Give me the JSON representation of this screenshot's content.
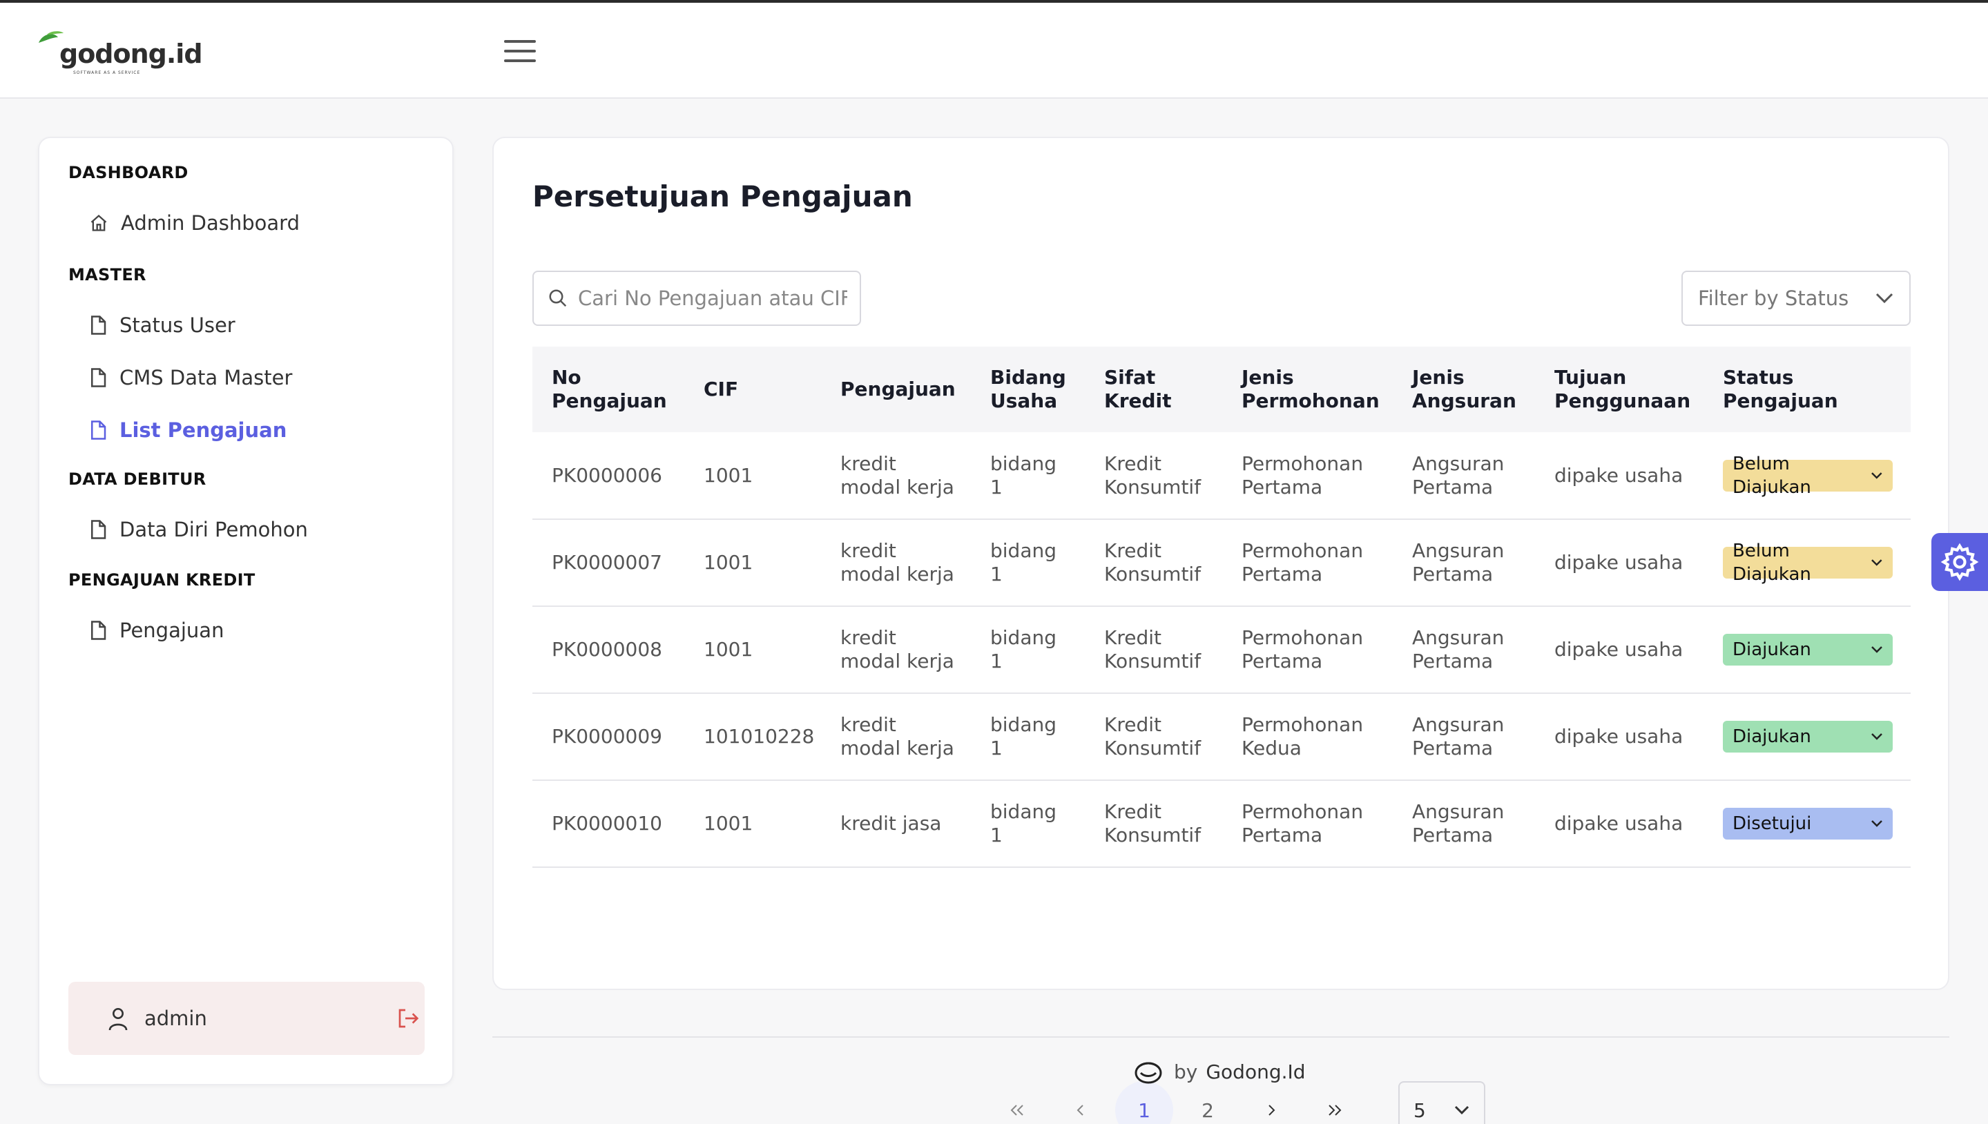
{
  "brand": {
    "name": "godong.id",
    "tagline": "SOFTWARE AS A SERVICE"
  },
  "sidebar": {
    "sections": [
      {
        "title": "DASHBOARD",
        "items": [
          {
            "label": "Admin Dashboard",
            "icon": "home-icon"
          }
        ]
      },
      {
        "title": "MASTER",
        "items": [
          {
            "label": "Status User",
            "icon": "file-icon"
          },
          {
            "label": "CMS Data Master",
            "icon": "file-icon"
          },
          {
            "label": "List Pengajuan",
            "icon": "file-icon",
            "active": true
          }
        ]
      },
      {
        "title": "DATA DEBITUR",
        "items": [
          {
            "label": "Data Diri Pemohon",
            "icon": "file-icon"
          }
        ]
      },
      {
        "title": "PENGAJUAN KREDIT",
        "items": [
          {
            "label": "Pengajuan",
            "icon": "file-icon"
          }
        ]
      }
    ],
    "user": {
      "name": "admin"
    }
  },
  "main": {
    "title": "Persetujuan Pengajuan",
    "search_placeholder": "Cari No Pengajuan atau CIF",
    "filter_label": "Filter by Status",
    "table": {
      "headers": [
        [
          "No",
          "Pengajuan"
        ],
        [
          "CIF"
        ],
        [
          "Pengajuan"
        ],
        [
          "Bidang",
          "Usaha"
        ],
        [
          "Sifat",
          "Kredit"
        ],
        [
          "Jenis",
          "Permohonan"
        ],
        [
          "Jenis",
          "Angsuran"
        ],
        [
          "Tujuan",
          "Penggunaan"
        ],
        [
          "Status",
          "Pengajuan"
        ]
      ],
      "rows": [
        {
          "no": "PK0000006",
          "cif": "1001",
          "pengajuan": [
            "kredit",
            "modal kerja"
          ],
          "bidang": [
            "bidang",
            "1"
          ],
          "sifat": [
            "Kredit",
            "Konsumtif"
          ],
          "jenis_permohonan": [
            "Permohonan",
            "Pertama"
          ],
          "jenis_angsuran": [
            "Angsuran",
            "Pertama"
          ],
          "tujuan": "dipake usaha",
          "status": "Belum Diajukan",
          "status_color": "#f3dd9a"
        },
        {
          "no": "PK0000007",
          "cif": "1001",
          "pengajuan": [
            "kredit",
            "modal kerja"
          ],
          "bidang": [
            "bidang",
            "1"
          ],
          "sifat": [
            "Kredit",
            "Konsumtif"
          ],
          "jenis_permohonan": [
            "Permohonan",
            "Pertama"
          ],
          "jenis_angsuran": [
            "Angsuran",
            "Pertama"
          ],
          "tujuan": "dipake usaha",
          "status": "Belum Diajukan",
          "status_color": "#f3dd9a"
        },
        {
          "no": "PK0000008",
          "cif": "1001",
          "pengajuan": [
            "kredit",
            "modal kerja"
          ],
          "bidang": [
            "bidang",
            "1"
          ],
          "sifat": [
            "Kredit",
            "Konsumtif"
          ],
          "jenis_permohonan": [
            "Permohonan",
            "Pertama"
          ],
          "jenis_angsuran": [
            "Angsuran",
            "Pertama"
          ],
          "tujuan": "dipake usaha",
          "status": "Diajukan",
          "status_color": "#9fe0b3"
        },
        {
          "no": "PK0000009",
          "cif": "101010228",
          "pengajuan": [
            "kredit",
            "modal kerja"
          ],
          "bidang": [
            "bidang",
            "1"
          ],
          "sifat": [
            "Kredit",
            "Konsumtif"
          ],
          "jenis_permohonan": [
            "Permohonan",
            "Kedua"
          ],
          "jenis_angsuran": [
            "Angsuran",
            "Pertama"
          ],
          "tujuan": "dipake usaha",
          "status": "Diajukan",
          "status_color": "#9fe0b3"
        },
        {
          "no": "PK0000010",
          "cif": "1001",
          "pengajuan": [
            "kredit jasa"
          ],
          "bidang": [
            "bidang",
            "1"
          ],
          "sifat": [
            "Kredit",
            "Konsumtif"
          ],
          "jenis_permohonan": [
            "Permohonan",
            "Pertama"
          ],
          "jenis_angsuran": [
            "Angsuran",
            "Pertama"
          ],
          "tujuan": "dipake usaha",
          "status": "Disetujui",
          "status_color": "#a9bdf1"
        }
      ]
    },
    "pagination": {
      "first": "«",
      "prev": "‹",
      "pages": [
        "1",
        "2"
      ],
      "current": "1",
      "next": "›",
      "last": "»",
      "page_size": "5"
    }
  },
  "footer": {
    "by": "by",
    "company": "Godong.Id"
  },
  "colors": {
    "accent": "#5b5fe0",
    "logout": "#d9534f"
  }
}
